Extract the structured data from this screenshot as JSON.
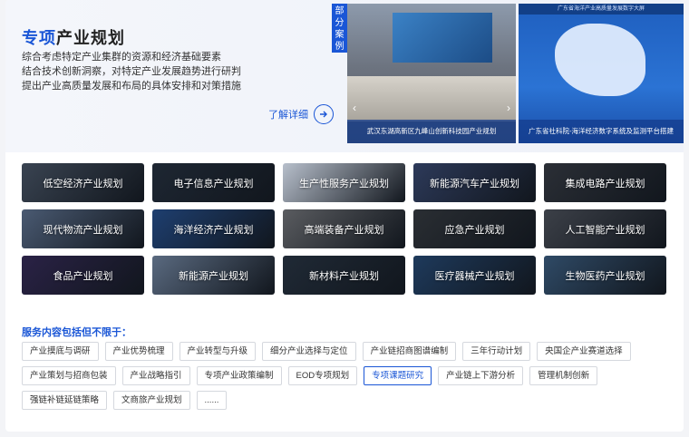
{
  "hero": {
    "title_accent": "专项",
    "title_rest": "产业规划",
    "desc_lines": [
      "综合考虑特定产业集群的资源和经济基础要素",
      "结合技术创新洞察，对特定产业发展趋势进行研判",
      "提出产业高质量发展和布局的具体安排和对策措施"
    ],
    "more_label": "了解详细",
    "case_tag": "部分案例",
    "cases": [
      {
        "caption": "武汉东湖高新区九峰山创新科技园产业规划"
      },
      {
        "caption": "广东省社科院-海洋经济数字系统及监测平台搭建",
        "screen_title": "广东省海洋产业高质量发展数字大屏"
      }
    ]
  },
  "tiles": [
    {
      "label": "低空经济产业规划",
      "bg": "#3a4452"
    },
    {
      "label": "电子信息产业规划",
      "bg": "#1e2733"
    },
    {
      "label": "生产性服务产业规划",
      "bg": "#b8c0cc"
    },
    {
      "label": "新能源汽车产业规划",
      "bg": "#2d3a5a"
    },
    {
      "label": "集成电路产业规划",
      "bg": "#2b2f36"
    },
    {
      "label": "现代物流产业规划",
      "bg": "#4a5a72"
    },
    {
      "label": "海洋经济产业规划",
      "bg": "#1e3f70"
    },
    {
      "label": "高端装备产业规划",
      "bg": "#5a5c60"
    },
    {
      "label": "应急产业规划",
      "bg": "#2a2e33"
    },
    {
      "label": "人工智能产业规划",
      "bg": "#3c4048"
    },
    {
      "label": "食品产业规划",
      "bg": "#2a2246"
    },
    {
      "label": "新能源产业规划",
      "bg": "#5a6a80"
    },
    {
      "label": "新材料产业规划",
      "bg": "#202a36"
    },
    {
      "label": "医疗器械产业规划",
      "bg": "#1e3a5c"
    },
    {
      "label": "生物医药产业规划",
      "bg": "#2f4a66"
    }
  ],
  "services_label": "服务内容包括但不限于：",
  "services": [
    "产业摸底与调研",
    "产业优势梳理",
    "产业转型与升级",
    "细分产业选择与定位",
    "产业链招商图谱编制",
    "三年行动计划",
    "央国企产业赛道选择",
    "产业策划与招商包装",
    "产业战略指引",
    "专项产业政策编制",
    "EOD专项规划",
    "专项课题研究",
    "产业链上下游分析",
    "管理机制创新",
    "强链补链延链策略",
    "文商旅产业规划",
    "......"
  ],
  "active_service_index": 11,
  "colors": {
    "accent": "#1a56d6"
  }
}
